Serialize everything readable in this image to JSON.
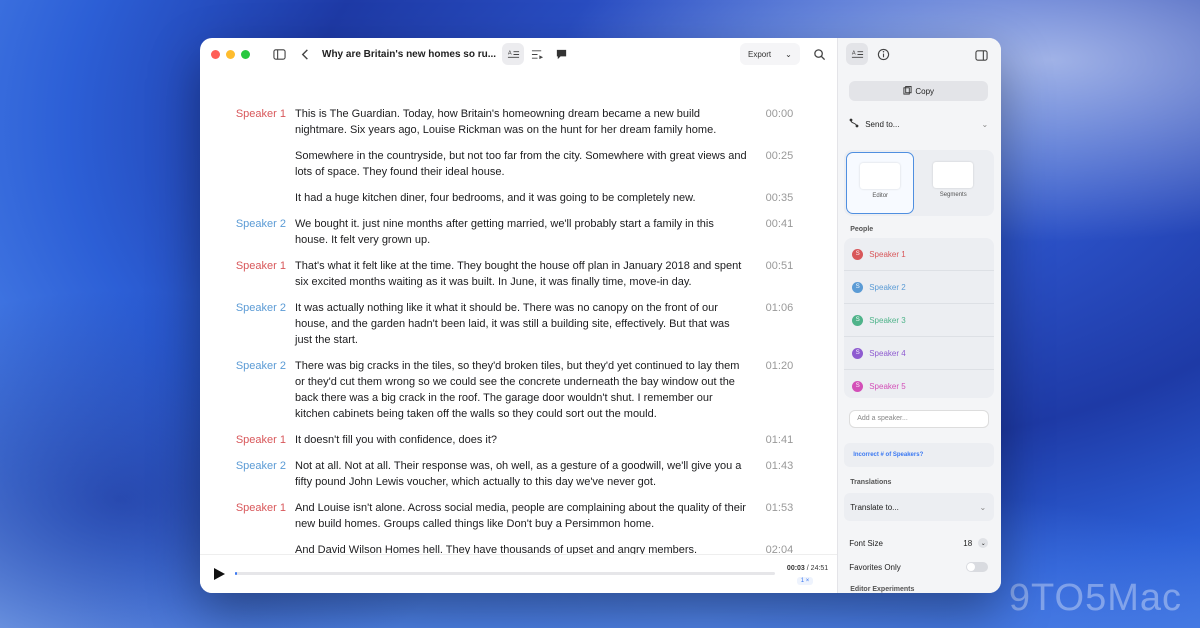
{
  "watermark": "9TO5Mac",
  "window": {
    "title": "Why are Britain's new homes so ru...",
    "export_label": "Export"
  },
  "speakers": {
    "Speaker 1": "#d8575a",
    "Speaker 2": "#5b9bd5"
  },
  "transcript": [
    {
      "speaker": "Speaker 1",
      "text": "This is The Guardian. Today, how Britain's homeowning dream became a new build nightmare. Six years ago, Louise Rickman was on the hunt for her dream family home.",
      "time": "00:00"
    },
    {
      "speaker": "",
      "text": "Somewhere in the countryside, but not too far from the city. Somewhere with great views and lots of space. They found their ideal house.",
      "time": "00:25"
    },
    {
      "speaker": "",
      "text": "It had a huge kitchen diner, four bedrooms, and it was going to be completely new.",
      "time": "00:35"
    },
    {
      "speaker": "Speaker 2",
      "text": "We bought it. just nine months after getting married, we'll probably start a family in this house. It felt very grown up.",
      "time": "00:41"
    },
    {
      "speaker": "Speaker 1",
      "text": "That's what it felt like at the time. They bought the house off plan in January 2018 and spent six excited months waiting as it was built. In June, it was finally time, move-in day.",
      "time": "00:51"
    },
    {
      "speaker": "Speaker 2",
      "text": "It was actually nothing like it what it should be. There was no canopy on the front of our house, and the garden hadn't been laid, it was still a building site, effectively. But that was just the start.",
      "time": "01:06"
    },
    {
      "speaker": "Speaker 2",
      "text": "There was big cracks in the tiles, so they'd broken tiles, but they'd yet continued to lay them or they'd cut them wrong so we could see the concrete underneath the bay window out the back there was a big crack in the roof. The garage door wouldn't shut. I remember our kitchen cabinets being taken off the walls so they could sort out the mould.",
      "time": "01:20"
    },
    {
      "speaker": "Speaker 1",
      "text": "It doesn't fill you with confidence, does it?",
      "time": "01:41"
    },
    {
      "speaker": "Speaker 2",
      "text": "Not at all. Not at all. Their response was, oh well, as a gesture of a goodwill, we'll give you a fifty pound John Lewis voucher, which actually to this day we've never got.",
      "time": "01:43"
    },
    {
      "speaker": "Speaker 1",
      "text": "And Louise isn't alone. Across social media, people are complaining about the quality of their new build homes. Groups called things like Don't buy a Persimmon home.",
      "time": "01:53"
    },
    {
      "speaker": "",
      "text": "And David Wilson Homes hell. They have thousands of upset and angry members.",
      "time": "02:04"
    }
  ],
  "player": {
    "current": "00:03",
    "separator": " / ",
    "total": "24:51",
    "speed": "1 ×",
    "progress": 0.002
  },
  "sidebar": {
    "copy_label": "Copy",
    "send_label": "Send to...",
    "modes": [
      {
        "label": "Editor",
        "active": true
      },
      {
        "label": "Segments",
        "active": false
      }
    ],
    "people_label": "People",
    "people": [
      {
        "name": "Speaker 1",
        "color": "#d8575a"
      },
      {
        "name": "Speaker 2",
        "color": "#5b9bd5"
      },
      {
        "name": "Speaker 3",
        "color": "#4fb38a"
      },
      {
        "name": "Speaker 4",
        "color": "#8e5bd0"
      },
      {
        "name": "Speaker 5",
        "color": "#d34fb8"
      }
    ],
    "add_speaker_placeholder": "Add a speaker...",
    "incorrect_label": "Incorrect # of Speakers?",
    "translations_label": "Translations",
    "translate_label": "Translate to...",
    "font_size_label": "Font Size",
    "font_size_value": "18",
    "favorites_label": "Favorites Only",
    "editor_experiments_label": "Editor Experiments"
  }
}
